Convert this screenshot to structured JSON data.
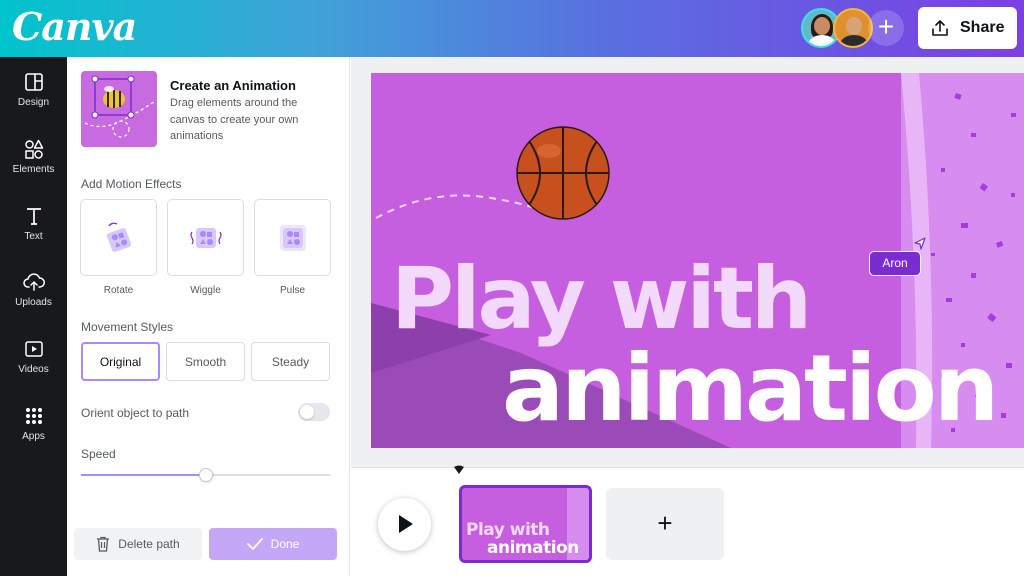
{
  "header": {
    "logo": "Canva",
    "share_label": "Share",
    "add_collaborator": "+",
    "colors": {
      "gradient_start": "#00c4cc",
      "gradient_end": "#7b3fe4"
    }
  },
  "leftnav": {
    "items": [
      {
        "label": "Design",
        "icon": "layout-icon"
      },
      {
        "label": "Elements",
        "icon": "shapes-icon"
      },
      {
        "label": "Text",
        "icon": "text-icon"
      },
      {
        "label": "Uploads",
        "icon": "cloud-upload-icon"
      },
      {
        "label": "Videos",
        "icon": "video-icon"
      },
      {
        "label": "Apps",
        "icon": "apps-grid-icon"
      }
    ]
  },
  "panel": {
    "intro": {
      "title": "Create an Animation",
      "description": "Drag elements around the canvas to create your own animations"
    },
    "motion_effects_title": "Add Motion Effects",
    "effects": [
      {
        "label": "Rotate",
        "icon": "rotate-icon"
      },
      {
        "label": "Wiggle",
        "icon": "wiggle-icon"
      },
      {
        "label": "Pulse",
        "icon": "pulse-icon"
      }
    ],
    "movement_styles_title": "Movement Styles",
    "styles": [
      {
        "label": "Original",
        "selected": true
      },
      {
        "label": "Smooth",
        "selected": false
      },
      {
        "label": "Steady",
        "selected": false
      }
    ],
    "orient_label": "Orient object to path",
    "orient_enabled": false,
    "speed_label": "Speed",
    "speed_value": 0.5,
    "delete_label": "Delete path",
    "done_label": "Done"
  },
  "canvas": {
    "line1": "Play with",
    "line2": "animation",
    "collaborator_tag": "Aron",
    "background": "#c65fdf"
  },
  "timeline": {
    "clip_line1": "Play with",
    "clip_line2": "animation",
    "add_page": "+"
  }
}
